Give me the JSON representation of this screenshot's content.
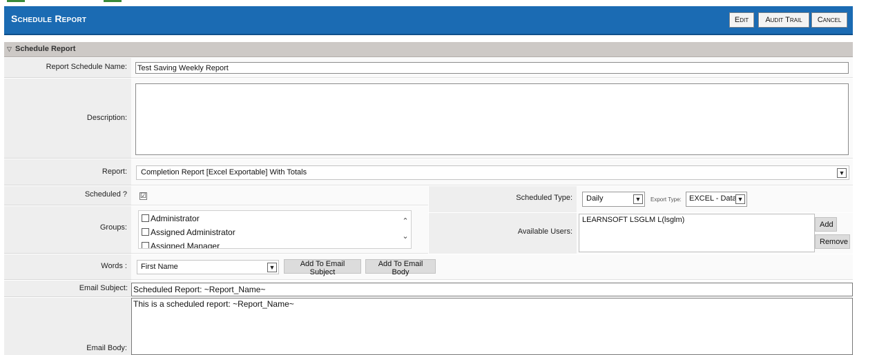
{
  "window": {
    "title": "Schedule Report",
    "actions": {
      "edit": "Edit",
      "audit_trail": "Audit Trail",
      "cancel": "Cancel"
    }
  },
  "section": {
    "title": "Schedule Report",
    "collapse_icon": "triangle-down-icon"
  },
  "form": {
    "report_schedule_name": {
      "label": "Report Schedule Name:",
      "value": "Test Saving Weekly Report"
    },
    "description": {
      "label": "Description:",
      "value": ""
    },
    "report": {
      "label": "Report:",
      "selected": "Completion Report [Excel Exportable] With Totals"
    },
    "scheduled": {
      "label": "Scheduled ?",
      "checked": true,
      "check_mark": "☑"
    },
    "scheduled_type": {
      "label": "Scheduled Type:",
      "selected": "Daily"
    },
    "export_type": {
      "label": "Export Type:",
      "selected": "EXCEL - Data"
    },
    "groups": {
      "label": "Groups:",
      "items": [
        "Administrator",
        "Assigned Administrator",
        "Assigned Manager"
      ]
    },
    "available_users": {
      "label": "Available Users:",
      "items": [
        "LEARNSOFT LSGLM L(lsglm)"
      ],
      "add_label": "Add",
      "remove_label": "Remove"
    },
    "words": {
      "label": "Words :",
      "selected": "First Name",
      "add_subject_label": "Add To Email Subject",
      "add_body_label": "Add To Email Body"
    },
    "email_subject": {
      "label": "Email Subject:",
      "value": "Scheduled Report: ~Report_Name~"
    },
    "email_body": {
      "label": "Email Body:",
      "value": "This is a scheduled report: ~Report_Name~"
    }
  },
  "icons": {
    "dropdown": "chevron-down-icon",
    "scroll_up": "chevron-up-icon",
    "scroll_down": "chevron-down-icon"
  },
  "colors": {
    "header_bg": "#1b6bb3",
    "section_bg": "#cdc9c6",
    "label_bg": "#eeeeee"
  }
}
